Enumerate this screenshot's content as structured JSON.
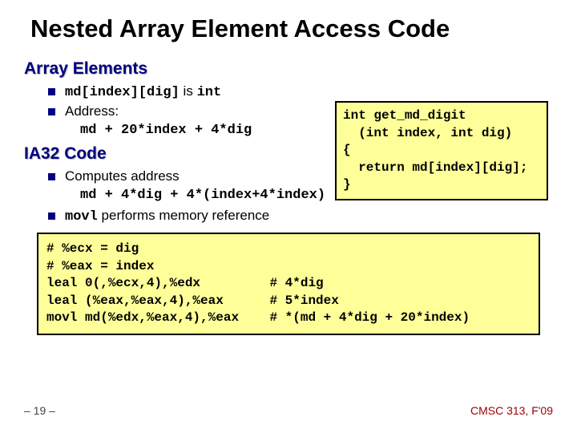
{
  "title": "Nested Array Element Access Code",
  "sections": {
    "arrayElements": {
      "heading": "Array Elements",
      "bullets": [
        {
          "pre": "md[index][dig]",
          "mid": " is ",
          "post": "int"
        },
        {
          "text": "Address:"
        }
      ],
      "addressExpr": "md + 20*index + 4*dig"
    },
    "ia32": {
      "heading": "IA32 Code",
      "bullets": [
        {
          "text": "Computes address"
        }
      ],
      "computeExpr": "md + 4*dig + 4*(index+4*index)",
      "bullets2": [
        {
          "pre": "movl",
          "text": " performs memory reference"
        }
      ]
    }
  },
  "codeSnippet": "int get_md_digit\n  (int index, int dig)\n{\n  return md[index][dig];\n}",
  "asm": "# %ecx = dig\n# %eax = index\nleal 0(,%ecx,4),%edx         # 4*dig\nleal (%eax,%eax,4),%eax      # 5*index\nmovl md(%edx,%eax,4),%eax    # *(md + 4*dig + 20*index)",
  "footer": {
    "left": "– 19 –",
    "right": "CMSC 313, F'09"
  }
}
